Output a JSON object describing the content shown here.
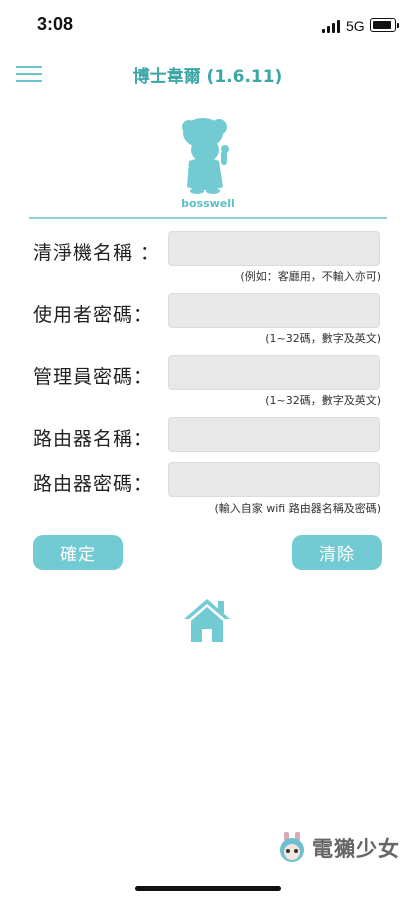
{
  "status_bar": {
    "time": "3:08",
    "network": "5G"
  },
  "header": {
    "title": "博士韋爾 (1.6.11)"
  },
  "logo": {
    "text": "bosswell"
  },
  "form": {
    "fields": [
      {
        "label": "清淨機名稱 ：",
        "value": "",
        "hint": "(例如：客廳用，不輸入亦可)"
      },
      {
        "label": "使用者密碼：",
        "value": "",
        "hint": "(1~32碼，數字及英文)"
      },
      {
        "label": "管理員密碼：",
        "value": "",
        "hint": "(1~32碼，數字及英文)"
      },
      {
        "label": "路由器名稱：",
        "value": "",
        "hint": ""
      },
      {
        "label": "路由器密碼：",
        "value": "",
        "hint": "(輸入自家 wifi 路由器名稱及密碼)"
      }
    ]
  },
  "buttons": {
    "confirm": "確定",
    "clear": "清除"
  },
  "icons": {
    "menu": "hamburger-icon",
    "home": "home-icon"
  },
  "watermark": {
    "text": "電獺少女"
  },
  "colors": {
    "accent": "#72cbd3",
    "title": "#3aa6a6",
    "divider": "#8dd1d4",
    "field_bg": "#e8e8e8"
  }
}
